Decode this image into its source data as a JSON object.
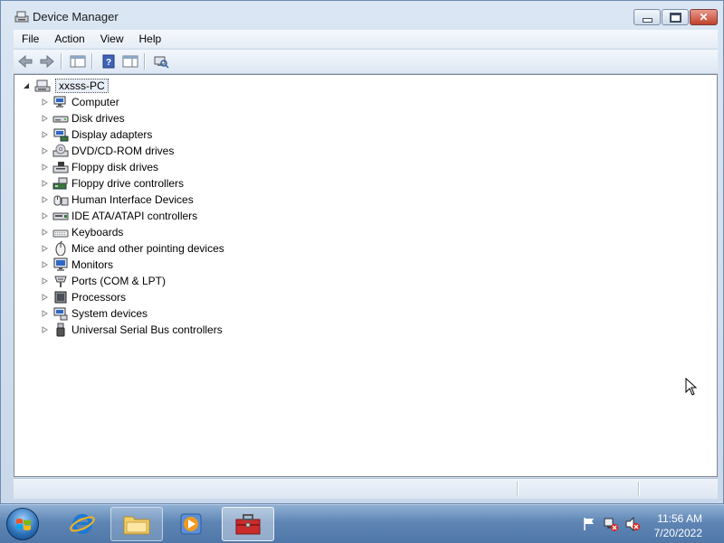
{
  "window": {
    "title": "Device Manager"
  },
  "menu": [
    "File",
    "Action",
    "View",
    "Help"
  ],
  "tree": {
    "root": "xxsss-PC",
    "nodes": [
      {
        "label": "Computer",
        "icon": "computer-icon"
      },
      {
        "label": "Disk drives",
        "icon": "disk-drive-icon"
      },
      {
        "label": "Display adapters",
        "icon": "display-adapter-icon"
      },
      {
        "label": "DVD/CD-ROM drives",
        "icon": "dvd-drive-icon"
      },
      {
        "label": "Floppy disk drives",
        "icon": "floppy-disk-icon"
      },
      {
        "label": "Floppy drive controllers",
        "icon": "floppy-controller-icon"
      },
      {
        "label": "Human Interface Devices",
        "icon": "hid-icon"
      },
      {
        "label": "IDE ATA/ATAPI controllers",
        "icon": "ide-controller-icon"
      },
      {
        "label": "Keyboards",
        "icon": "keyboard-icon"
      },
      {
        "label": "Mice and other pointing devices",
        "icon": "mouse-icon"
      },
      {
        "label": "Monitors",
        "icon": "monitor-icon"
      },
      {
        "label": "Ports (COM & LPT)",
        "icon": "port-icon"
      },
      {
        "label": "Processors",
        "icon": "processor-icon"
      },
      {
        "label": "System devices",
        "icon": "system-devices-icon"
      },
      {
        "label": "Universal Serial Bus controllers",
        "icon": "usb-icon"
      }
    ]
  },
  "taskbar": {
    "clock": {
      "time": "11:56 AM",
      "date": "7/20/2022"
    }
  }
}
